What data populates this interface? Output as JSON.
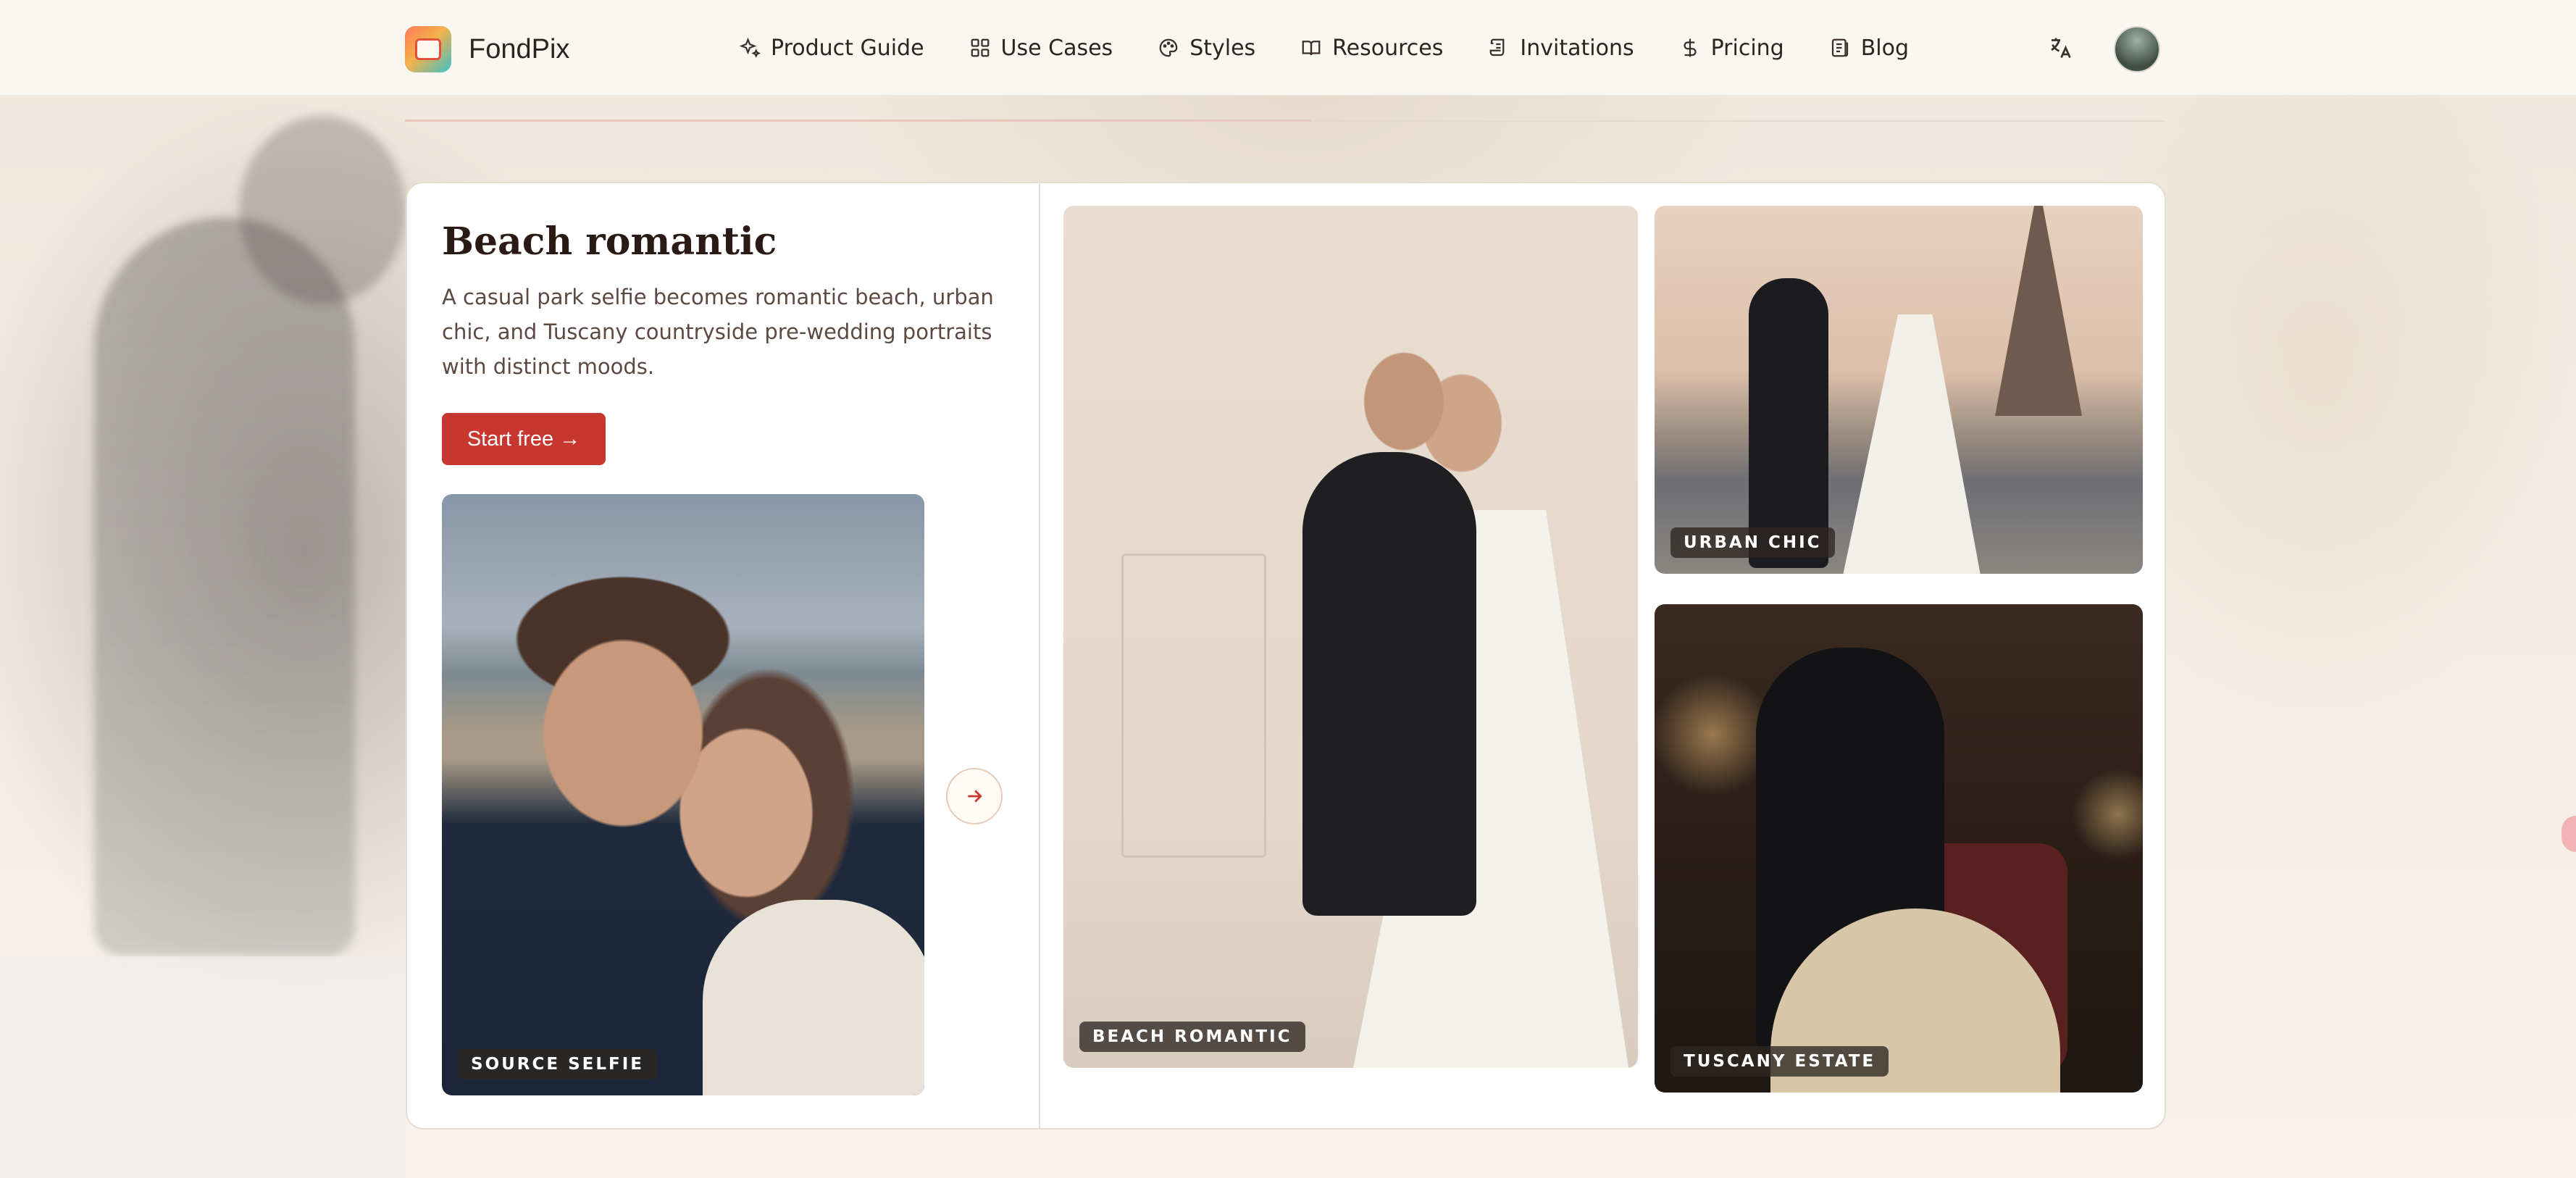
{
  "brand": {
    "name": "FondPix"
  },
  "nav": {
    "items": [
      {
        "label": "Product Guide",
        "icon": "sparkles-icon"
      },
      {
        "label": "Use Cases",
        "icon": "grid-icon"
      },
      {
        "label": "Styles",
        "icon": "palette-icon"
      },
      {
        "label": "Resources",
        "icon": "book-icon"
      },
      {
        "label": "Invitations",
        "icon": "scroll-icon"
      },
      {
        "label": "Pricing",
        "icon": "dollar-icon"
      },
      {
        "label": "Blog",
        "icon": "newspaper-icon"
      }
    ],
    "translate_icon": "translate-icon"
  },
  "card": {
    "title": "Beach romantic",
    "description": "A casual park selfie becomes romantic beach, urban chic, and Tuscany countryside pre-wedding portraits with distinct moods.",
    "cta_label": "Start free →",
    "source_tag": "SOURCE SELFIE",
    "results": [
      {
        "tag": "BEACH ROMANTIC"
      },
      {
        "tag": "URBAN CHIC"
      },
      {
        "tag": "TUSCANY ESTATE"
      }
    ]
  },
  "colors": {
    "accent": "#c8372f",
    "text": "#2a1a14"
  }
}
